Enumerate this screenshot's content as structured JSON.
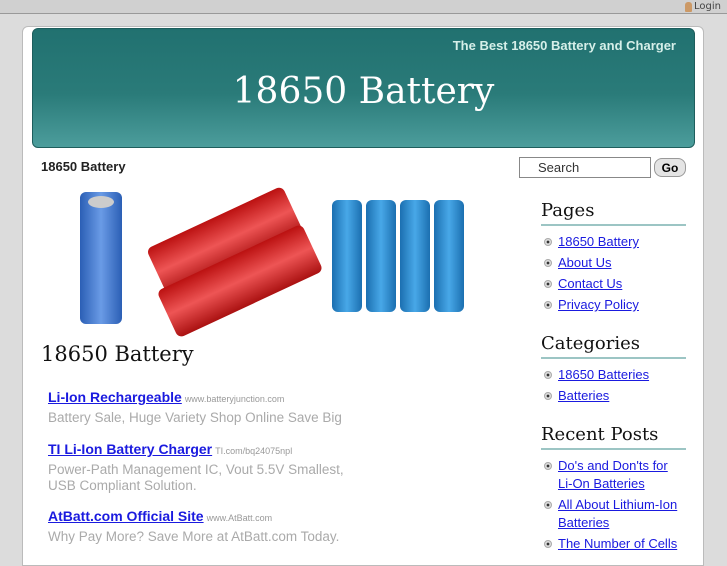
{
  "topbar": {
    "login": "Login"
  },
  "header": {
    "tagline": "The Best 18650 Battery and Charger",
    "title": "18650 Battery"
  },
  "breadcrumb": "18650 Battery",
  "search": {
    "placeholder": "Search",
    "button": "Go"
  },
  "post": {
    "title": "18650 Battery"
  },
  "ads": [
    {
      "title": "Li-Ion Rechargeable",
      "url": "www.batteryjunction.com",
      "desc": "Battery Sale, Huge Variety Shop Online Save Big"
    },
    {
      "title": "TI Li-Ion Battery Charger",
      "url": "TI.com/bq24075npl",
      "desc": "Power-Path Management IC, Vout 5.5V Smallest, USB Compliant Solution."
    },
    {
      "title": "AtBatt.com Official Site",
      "url": "www.AtBatt.com",
      "desc": "Why Pay More? Save More at AtBatt.com Today."
    }
  ],
  "sidebar": {
    "pages": {
      "title": "Pages",
      "items": [
        "18650 Battery",
        "About Us",
        "Contact Us",
        "Privacy Policy"
      ]
    },
    "categories": {
      "title": "Categories",
      "items": [
        "18650 Batteries",
        "Batteries"
      ]
    },
    "recent": {
      "title": "Recent Posts",
      "items": [
        "Do's and Don'ts for Li-On Batteries",
        "All About Lithium-Ion Batteries",
        "The Number of Cells"
      ]
    }
  },
  "colors": {
    "header": "#2a7b79",
    "link": "#1a1adf"
  }
}
